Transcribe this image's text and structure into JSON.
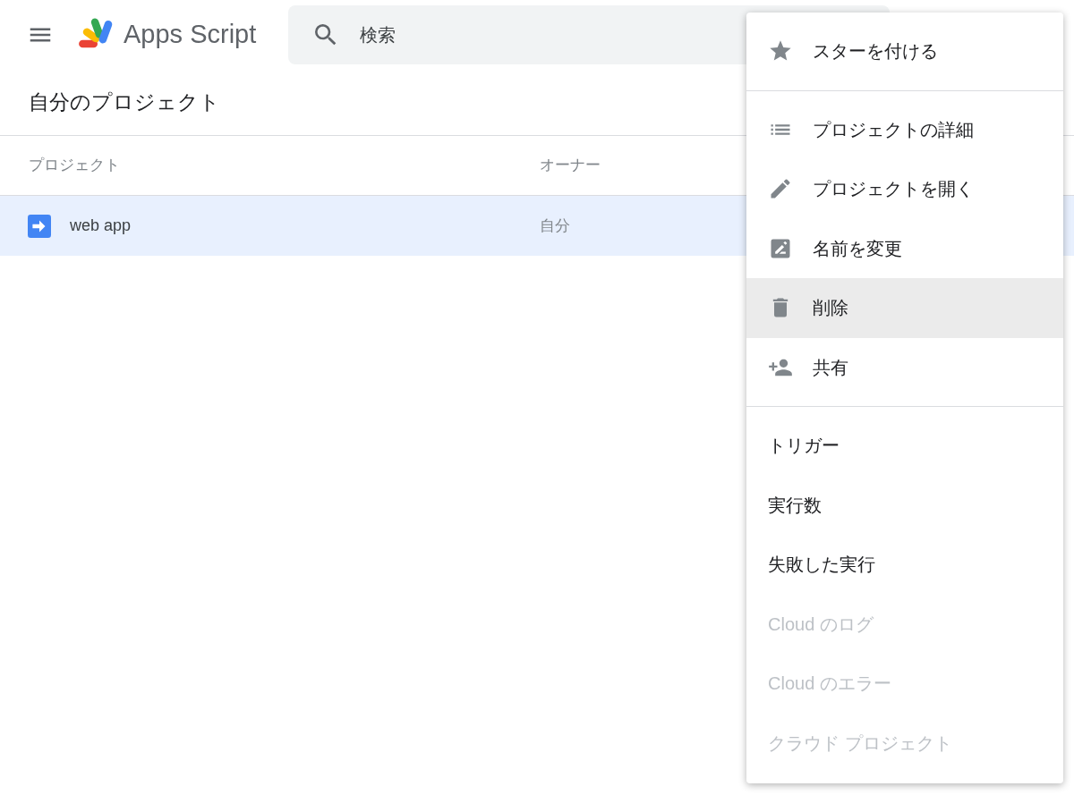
{
  "header": {
    "app_name": "Apps Script",
    "search": {
      "placeholder": "検索"
    }
  },
  "page_title": "自分のプロジェクト",
  "table": {
    "columns": [
      "プロジェクト",
      "オーナー"
    ],
    "rows": [
      {
        "name": "web app",
        "owner": "自分",
        "selected": true
      }
    ]
  },
  "context_menu": {
    "groups": [
      {
        "items": [
          {
            "kind": "icon",
            "label": "スターを付ける",
            "disabled": false,
            "highlighted": false
          }
        ]
      },
      {
        "items": [
          {
            "kind": "icon",
            "label": "プロジェクトの詳細",
            "disabled": false,
            "highlighted": false
          },
          {
            "kind": "icon",
            "label": "プロジェクトを開く",
            "disabled": false,
            "highlighted": false
          },
          {
            "kind": "icon",
            "label": "名前を変更",
            "disabled": false,
            "highlighted": false
          },
          {
            "kind": "icon",
            "label": "削除",
            "disabled": false,
            "highlighted": true
          },
          {
            "kind": "icon",
            "label": "共有",
            "disabled": false,
            "highlighted": false
          }
        ]
      },
      {
        "items": [
          {
            "kind": "text",
            "label": "トリガー",
            "disabled": false,
            "highlighted": false
          },
          {
            "kind": "text",
            "label": "実行数",
            "disabled": false,
            "highlighted": false
          },
          {
            "kind": "text",
            "label": "失敗した実行",
            "disabled": false,
            "highlighted": false
          },
          {
            "kind": "text",
            "label": "Cloud のログ",
            "disabled": true,
            "highlighted": false
          },
          {
            "kind": "text",
            "label": "Cloud のエラー",
            "disabled": true,
            "highlighted": false
          },
          {
            "kind": "text",
            "label": "クラウド プロジェクト",
            "disabled": true,
            "highlighted": false
          }
        ]
      }
    ]
  }
}
